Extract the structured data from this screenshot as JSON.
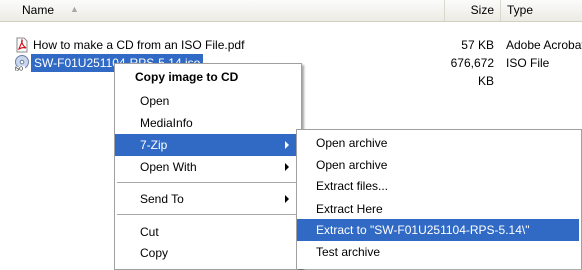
{
  "columns": {
    "name": "Name",
    "size": "Size",
    "type": "Type"
  },
  "files": [
    {
      "name": "How to make a CD from an ISO File.pdf",
      "size": "57 KB",
      "type": "Adobe Acrobat Doc",
      "icon": "pdf-icon"
    },
    {
      "name": "SW-F01U251104-RPS-5.14.iso",
      "size": "676,672 KB",
      "type": "ISO File",
      "icon": "iso-disc-icon"
    }
  ],
  "context_menu": {
    "default_item": "Copy image to CD",
    "open": "Open",
    "mediainfo": "MediaInfo",
    "sevenzip": "7-Zip",
    "open_with": "Open With",
    "send_to": "Send To",
    "cut": "Cut",
    "copy": "Copy"
  },
  "submenu_7zip": {
    "items": [
      "Open archive",
      "Open archive",
      "Extract files...",
      "Extract Here",
      "Extract to \"SW-F01U251104-RPS-5.14\\\"",
      "Test archive"
    ]
  },
  "colors": {
    "selection": "#316ac5",
    "header_bg": "#ecebe4"
  }
}
